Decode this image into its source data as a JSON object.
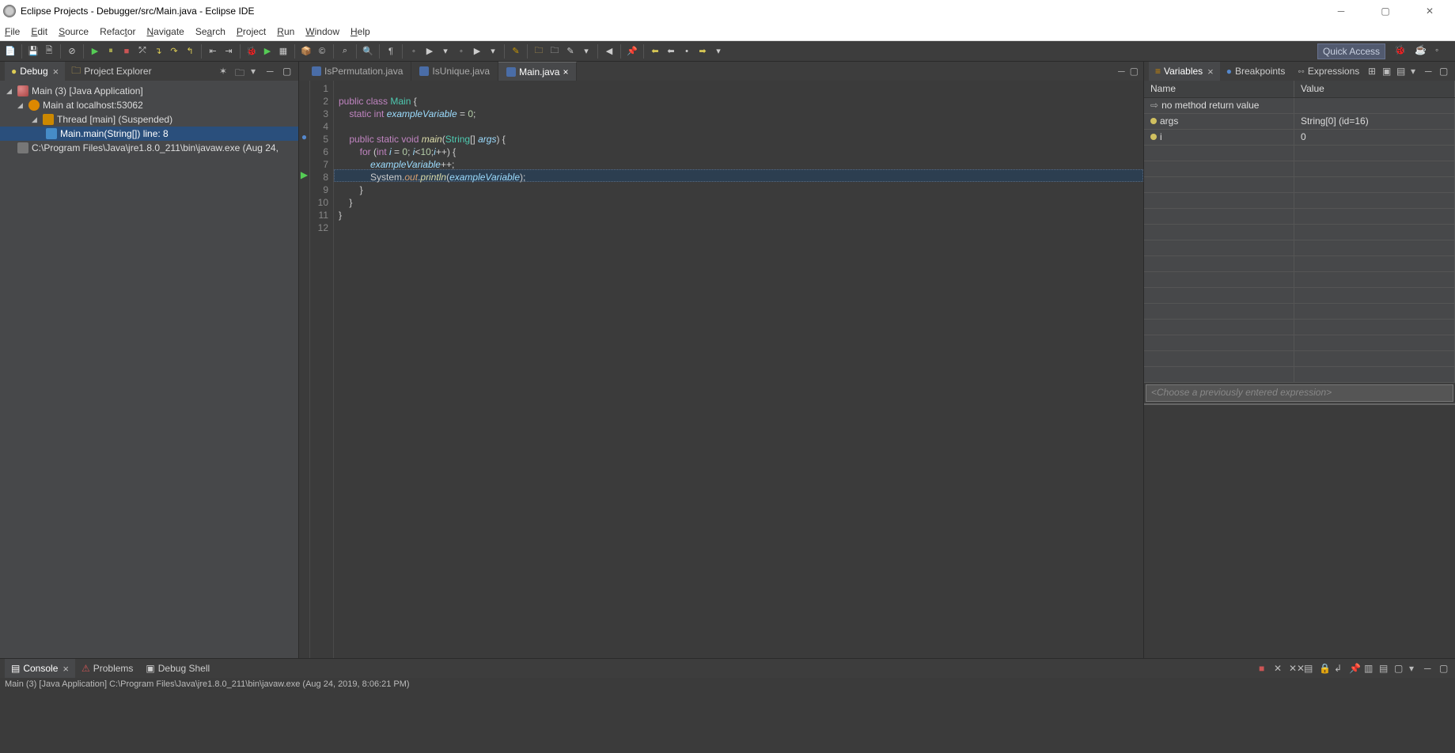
{
  "window": {
    "title": "Eclipse Projects - Debugger/src/Main.java - Eclipse IDE"
  },
  "menubar": [
    "File",
    "Edit",
    "Source",
    "Refactor",
    "Navigate",
    "Search",
    "Project",
    "Run",
    "Window",
    "Help"
  ],
  "quick_access": "Quick Access",
  "left": {
    "tabs": {
      "debug": "Debug",
      "explorer": "Project Explorer"
    },
    "tree": {
      "root": "Main (3) [Java Application]",
      "target": "Main at localhost:53062",
      "thread": "Thread [main] (Suspended)",
      "frame": "Main.main(String[]) line: 8",
      "exe": "C:\\Program Files\\Java\\jre1.8.0_211\\bin\\javaw.exe (Aug 24,"
    }
  },
  "editor": {
    "tabs": [
      {
        "label": "IsPermutation.java",
        "active": false
      },
      {
        "label": "IsUnique.java",
        "active": false
      },
      {
        "label": "Main.java",
        "active": true
      }
    ],
    "lines": [
      "1",
      "2",
      "3",
      "4",
      "5",
      "6",
      "7",
      "8",
      "9",
      "10",
      "11",
      "12"
    ]
  },
  "code": {
    "l2a": "public class ",
    "l2b": "Main ",
    "l2c": "{",
    "l3a": "    static int ",
    "l3b": "exampleVariable",
    "l3c": " = ",
    "l3d": "0",
    "l3e": ";",
    "l5a": "    public static void ",
    "l5b": "main",
    "l5c": "(",
    "l5d": "String",
    "l5e": "[] ",
    "l5f": "args",
    "l5g": ") {",
    "l6a": "        for ",
    "l6b": "(",
    "l6c": "int ",
    "l6d": "i",
    "l6e": " = ",
    "l6f": "0",
    "l6g": "; ",
    "l6h": "i",
    "l6i": "<",
    "l6j": "10",
    "l6k": ";",
    "l6l": "i",
    "l6m": "++) {",
    "l7a": "            ",
    "l7b": "exampleVariable",
    "l7c": "++;",
    "l8a": "            System.",
    "l8b": "out",
    "l8c": ".",
    "l8d": "println",
    "l8e": "(",
    "l8f": "exampleVariable",
    "l8g": ");",
    "l9": "        }",
    "l10": "    }",
    "l11": "}"
  },
  "vars": {
    "tabs": {
      "variables": "Variables",
      "breakpoints": "Breakpoints",
      "expressions": "Expressions"
    },
    "head": {
      "name": "Name",
      "value": "Value"
    },
    "rows": [
      {
        "name": "no method return value",
        "value": ""
      },
      {
        "name": "args",
        "value": "String[0]  (id=16)"
      },
      {
        "name": "i",
        "value": "0"
      }
    ],
    "expr_placeholder": "<Choose a previously entered expression>"
  },
  "bottom": {
    "tabs": {
      "console": "Console",
      "problems": "Problems",
      "debugshell": "Debug Shell"
    },
    "info": "Main (3) [Java Application] C:\\Program Files\\Java\\jre1.8.0_211\\bin\\javaw.exe (Aug 24, 2019, 8:06:21 PM)"
  }
}
